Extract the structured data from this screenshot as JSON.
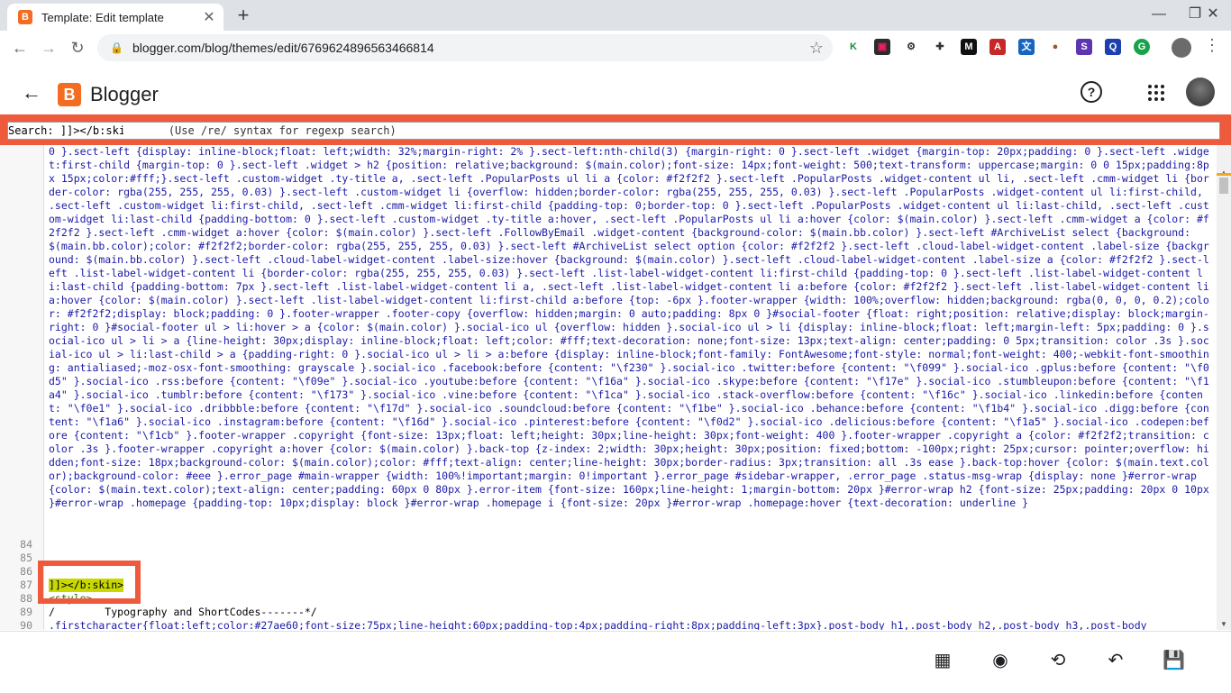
{
  "browser": {
    "tab_title": "Template: Edit template",
    "tab_favicon": "B",
    "new_tab": "+",
    "url": "blogger.com/blog/themes/edit/6769624896563466814",
    "window_controls": [
      "—",
      "❐",
      "✕"
    ]
  },
  "app": {
    "name": "Blogger",
    "logo_letter": "B",
    "help_icon": "?",
    "colors": {
      "accent": "#f36c21",
      "highlight_box": "#ee5a3c",
      "cdata_highlight": "#c8d800"
    }
  },
  "search": {
    "label": "Search:",
    "value": "]]></b:skin>",
    "hint": "(Use /re/ syntax for regexp search)"
  },
  "editor": {
    "wrapped_css": "0 }.sect-left {display: inline-block;float: left;width: 32%;margin-right: 2% }.sect-left:nth-child(3) {margin-right: 0 }.sect-left .widget {margin-top: 20px;padding: 0 }.sect-left .widget:first-child {margin-top: 0 }.sect-left .widget > h2 {position: relative;background: $(main.color);font-size: 14px;font-weight: 500;text-transform: uppercase;margin: 0 0 15px;padding:8px 15px;color:#fff;}.sect-left .custom-widget .ty-title a, .sect-left .PopularPosts ul li a {color: #f2f2f2 }.sect-left .PopularPosts .widget-content ul li, .sect-left .cmm-widget li {border-color: rgba(255, 255, 255, 0.03) }.sect-left .custom-widget li {overflow: hidden;border-color: rgba(255, 255, 255, 0.03) }.sect-left .PopularPosts .widget-content ul li:first-child, .sect-left .custom-widget li:first-child, .sect-left .cmm-widget li:first-child {padding-top: 0;border-top: 0 }.sect-left .PopularPosts .widget-content ul li:last-child, .sect-left .custom-widget li:last-child {padding-bottom: 0 }.sect-left .custom-widget .ty-title a:hover, .sect-left .PopularPosts ul li a:hover {color: $(main.color) }.sect-left .cmm-widget a {color: #f2f2f2 }.sect-left .cmm-widget a:hover {color: $(main.color) }.sect-left .FollowByEmail .widget-content {background-color: $(main.bb.color) }.sect-left #ArchiveList select {background: $(main.bb.color);color: #f2f2f2;border-color: rgba(255, 255, 255, 0.03) }.sect-left #ArchiveList select option {color: #f2f2f2 }.sect-left .cloud-label-widget-content .label-size {background: $(main.bb.color) }.sect-left .cloud-label-widget-content .label-size:hover {background: $(main.color) }.sect-left .cloud-label-widget-content .label-size a {color: #f2f2f2 }.sect-left .list-label-widget-content li {border-color: rgba(255, 255, 255, 0.03) }.sect-left .list-label-widget-content li:first-child {padding-top: 0 }.sect-left .list-label-widget-content li:last-child {padding-bottom: 7px }.sect-left .list-label-widget-content li a, .sect-left .list-label-widget-content li a:before {color: #f2f2f2 }.sect-left .list-label-widget-content li a:hover {color: $(main.color) }.sect-left .list-label-widget-content li:first-child a:before {top: -6px }.footer-wrapper {width: 100%;overflow: hidden;background: rgba(0, 0, 0, 0.2);color: #f2f2f2;display: block;padding: 0 }.footer-wrapper .footer-copy {overflow: hidden;margin: 0 auto;padding: 8px 0 }#social-footer {float: right;position: relative;display: block;margin-right: 0 }#social-footer ul > li:hover > a {color: $(main.color) }.social-ico ul {overflow: hidden }.social-ico ul > li {display: inline-block;float: left;margin-left: 5px;padding: 0 }.social-ico ul > li > a {line-height: 30px;display: inline-block;float: left;color: #fff;text-decoration: none;font-size: 13px;text-align: center;padding: 0 5px;transition: color .3s }.social-ico ul > li:last-child > a {padding-right: 0 }.social-ico ul > li > a:before {display: inline-block;font-family: FontAwesome;font-style: normal;font-weight: 400;-webkit-font-smoothing: antialiased;-moz-osx-font-smoothing: grayscale }.social-ico .facebook:before {content: \"\\f230\" }.social-ico .twitter:before {content: \"\\f099\" }.social-ico .gplus:before {content: \"\\f0d5\" }.social-ico .rss:before {content: \"\\f09e\" }.social-ico .youtube:before {content: \"\\f16a\" }.social-ico .skype:before {content: \"\\f17e\" }.social-ico .stumbleupon:before {content: \"\\f1a4\" }.social-ico .tumblr:before {content: \"\\f173\" }.social-ico .vine:before {content: \"\\f1ca\" }.social-ico .stack-overflow:before {content: \"\\f16c\" }.social-ico .linkedin:before {content: \"\\f0e1\" }.social-ico .dribbble:before {content: \"\\f17d\" }.social-ico .soundcloud:before {content: \"\\f1be\" }.social-ico .behance:before {content: \"\\f1b4\" }.social-ico .digg:before {content: \"\\f1a6\" }.social-ico .instagram:before {content: \"\\f16d\" }.social-ico .pinterest:before {content: \"\\f0d2\" }.social-ico .delicious:before {content: \"\\f1a5\" }.social-ico .codepen:before {content: \"\\f1cb\" }.footer-wrapper .copyright {font-size: 13px;float: left;height: 30px;line-height: 30px;font-weight: 400 }.footer-wrapper .copyright a {color: #f2f2f2;transition: color .3s }.footer-wrapper .copyright a:hover {color: $(main.color) }.back-top {z-index: 2;width: 30px;height: 30px;position: fixed;bottom: -100px;right: 25px;cursor: pointer;overflow: hidden;font-size: 18px;background-color: $(main.color);color: #fff;text-align: center;line-height: 30px;border-radius: 3px;transition: all .3s ease }.back-top:hover {color: $(main.text.color);background-color: #eee }.error_page #main-wrapper {width: 100%!important;margin: 0!important }.error_page #sidebar-wrapper, .error_page .status-msg-wrap {display: none }#error-wrap {color: $(main.text.color);text-align: center;padding: 60px 0 80px }.error-item {font-size: 160px;line-height: 1;margin-bottom: 20px }#error-wrap h2 {font-size: 25px;padding: 20px 0 10px }#error-wrap .homepage {padding-top: 10px;display: block }#error-wrap .homepage i {font-size: 20px }#error-wrap .homepage:hover {text-decoration: underline }",
    "lines": [
      {
        "num": "84",
        "text": ""
      },
      {
        "num": "85",
        "text": ""
      },
      {
        "num": "86",
        "text": ""
      },
      {
        "num": "87",
        "text": "]]></b:skin>"
      },
      {
        "num": "88",
        "text": "<style>"
      },
      {
        "num": "89",
        "text": "/        Typography and ShortCodes-------*/"
      },
      {
        "num": "90",
        "text": ".firstcharacter{float:left;color:#27ae60;font-size:75px;line-height:60px;padding-top:4px;padding-right:8px;padding-left:3px}.post-body h1,.post-body h2,.post-body h3,.post-body"
      }
    ]
  },
  "footer": {
    "icons": [
      "widgets-icon",
      "preview-icon",
      "restore-icon",
      "undo-icon",
      "save-icon"
    ]
  }
}
